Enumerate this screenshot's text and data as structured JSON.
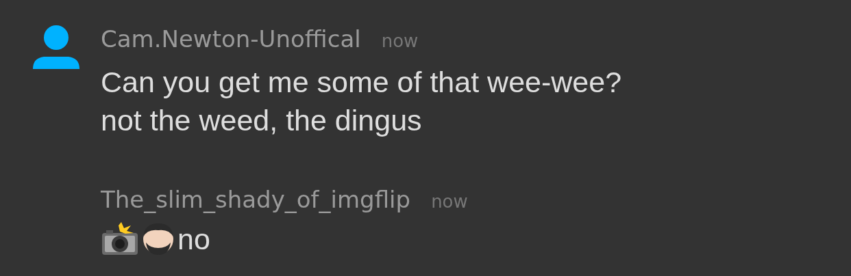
{
  "messages": [
    {
      "kind": "text",
      "avatar": true,
      "author": "Cam.Newton-Unoffical",
      "time": "now",
      "lines": [
        "Can you get me some of that wee-wee?",
        "not the weed, the dingus"
      ]
    },
    {
      "kind": "emoji_reply",
      "avatar": false,
      "author": "The_slim_shady_of_imgflip",
      "time": "now",
      "lines": [
        "no"
      ]
    }
  ]
}
